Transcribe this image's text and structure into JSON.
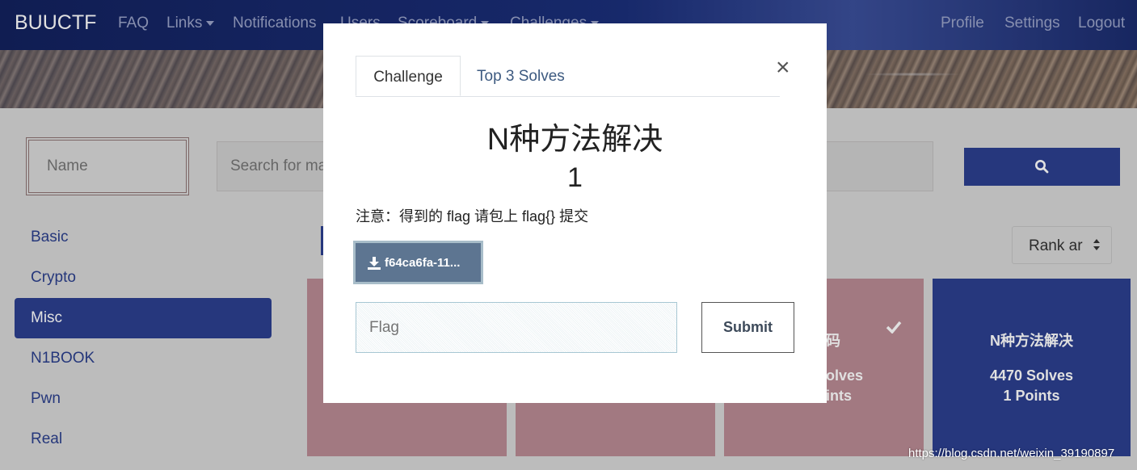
{
  "navbar": {
    "brand": "BUUCTF",
    "items": [
      "FAQ",
      "Links",
      "Notifications",
      "Users",
      "Scoreboard",
      "Challenges"
    ],
    "right": [
      "Profile",
      "Settings",
      "Logout"
    ]
  },
  "filters": {
    "name_placeholder": "Name",
    "search_placeholder": "Search for matching challenge",
    "sort_value": "Rank ar"
  },
  "categories": [
    "Basic",
    "Crypto",
    "Misc",
    "N1BOOK",
    "Pwn",
    "Real"
  ],
  "active_category": "Misc",
  "cards": {
    "partial_title": "码",
    "partial_solves": "olves",
    "partial_points": "ints",
    "card4_title": "N种方法解决",
    "card4_solves": "4470 Solves",
    "card4_points": "1 Points"
  },
  "watermark": "https://blog.csdn.net/weixin_39190897",
  "modal": {
    "tab_challenge": "Challenge",
    "tab_solves": "Top 3 Solves",
    "close": "×",
    "title": "N种方法解决",
    "value": "1",
    "description": "注意：得到的 flag 请包上 flag{} 提交",
    "file_label": "f64ca6fa-11...",
    "flag_placeholder": "Flag",
    "submit_label": "Submit"
  },
  "colors": {
    "navbar": "#1b2f7a",
    "primary": "#2c3f8f",
    "card_solved": "#b98a93"
  }
}
